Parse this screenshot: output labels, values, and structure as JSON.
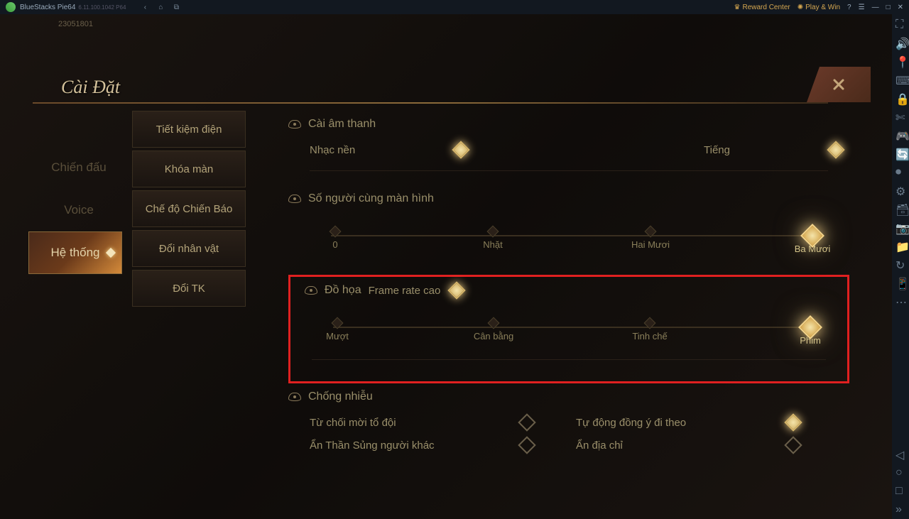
{
  "topbar": {
    "name": "BlueStacks Pie64",
    "sub": "6.11.100.1042 P64",
    "reward": "Reward Center",
    "play": "Play & Win"
  },
  "version": "23051801",
  "panel_title": "Cài Đặt",
  "left_tabs": {
    "combat": "Chiến đấu",
    "voice": "Voice",
    "system": "Hệ thống"
  },
  "mid_buttons": [
    "Tiết kiệm điện",
    "Khóa màn",
    "Chế độ Chiến Báo",
    "Đổi nhân vật",
    "Đổi TK"
  ],
  "sections": {
    "audio": {
      "title": "Cài âm thanh",
      "bg_music": "Nhạc nền",
      "sound": "Tiếng"
    },
    "players": {
      "title": "Số người cùng màn hình",
      "opts": [
        "0",
        "Nhặt",
        "Hai Mươi",
        "Ba Mươi"
      ]
    },
    "graphics": {
      "title": "Đồ họa",
      "framerate": "Frame rate cao",
      "opts": [
        "Mượt",
        "Cân bằng",
        "Tinh chế",
        "Phim"
      ]
    },
    "disturb": {
      "title": "Chống nhiễu",
      "reject_party": "Từ chối mời tổ đội",
      "auto_follow": "Tự động đồng ý đi theo",
      "hide_pet": "Ẩn Thần Sủng người khác",
      "hide_addr": "Ẩn địa chỉ"
    }
  }
}
